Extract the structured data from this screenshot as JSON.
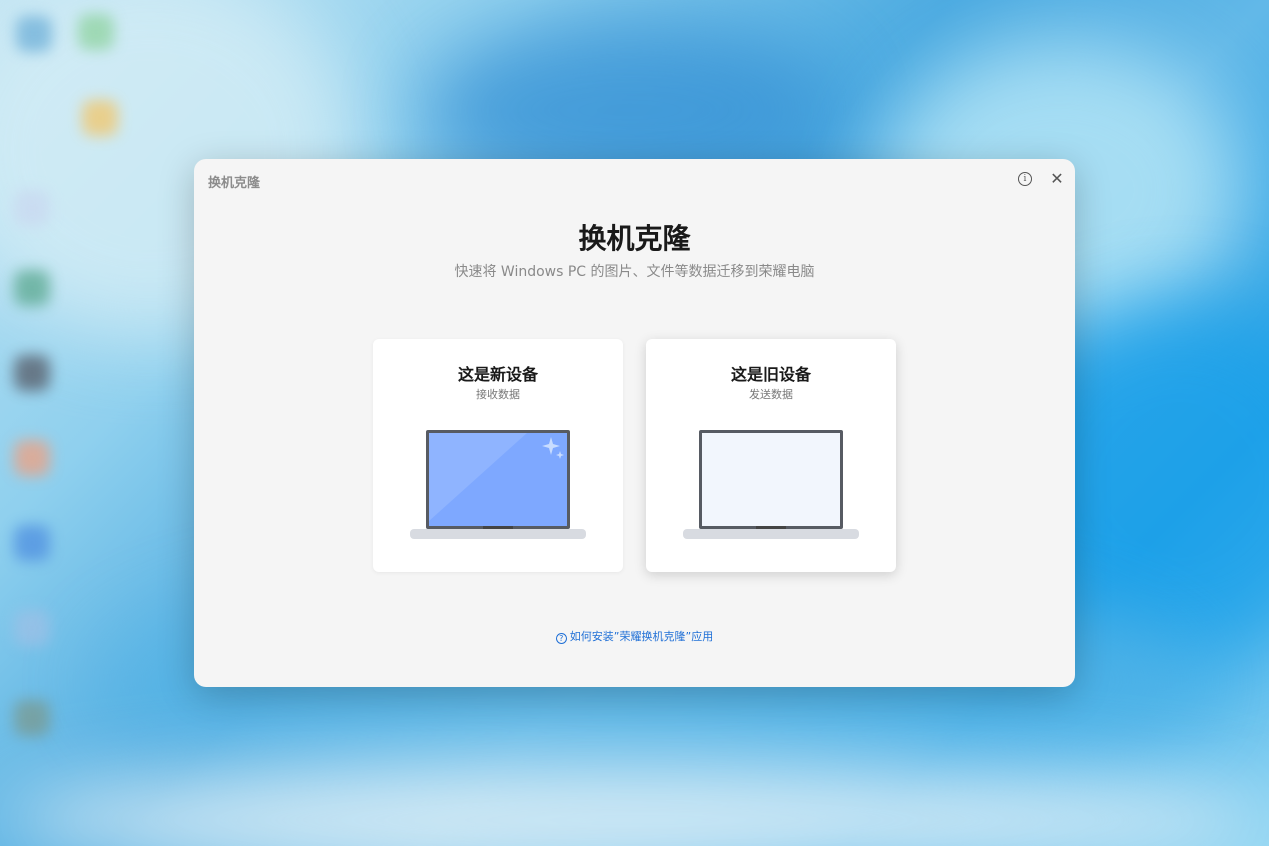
{
  "window": {
    "title": "换机克隆",
    "info_icon": "info-icon",
    "close_icon": "close-icon"
  },
  "header": {
    "title": "换机克隆",
    "subtitle": "快速将 Windows PC 的图片、文件等数据迁移到荣耀电脑"
  },
  "options": [
    {
      "title": "这是新设备",
      "subtitle": "接收数据",
      "illustration": "laptop-new-icon",
      "screen_color": "#7ea8ff"
    },
    {
      "title": "这是旧设备",
      "subtitle": "发送数据",
      "illustration": "laptop-old-icon",
      "screen_color": "#f2f6fd"
    }
  ],
  "help": {
    "icon": "question-circle-icon",
    "label": "如何安装”荣耀换机克隆”应用"
  },
  "colors": {
    "link": "#1f6fd6",
    "dialog_bg": "#f5f5f5",
    "card_bg": "#ffffff"
  }
}
